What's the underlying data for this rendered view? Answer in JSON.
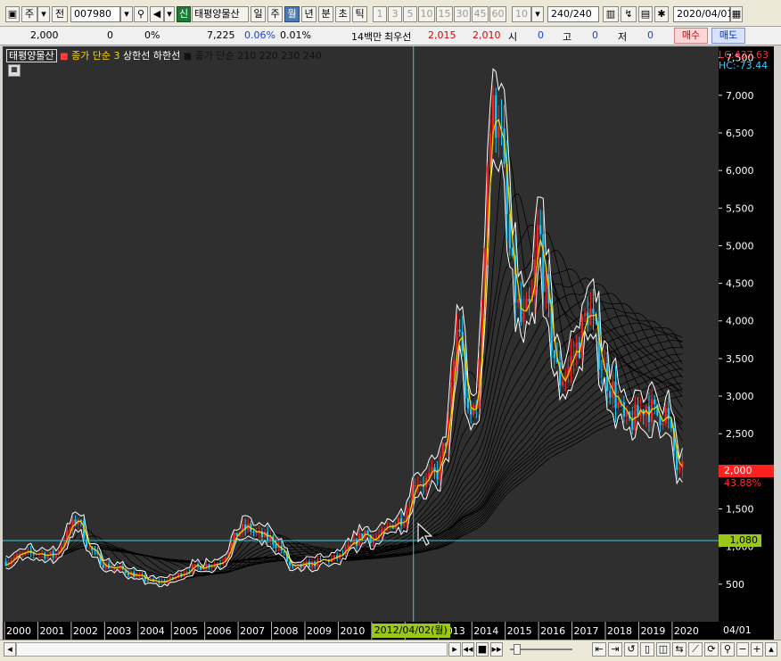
{
  "toolbar": {
    "market": "주",
    "prev_label": "전",
    "code": "007980",
    "credit_badge": "신",
    "stock_name": "태평양물산",
    "periods": [
      "일",
      "주",
      "월",
      "년",
      "분",
      "초",
      "틱"
    ],
    "selected_period": "월",
    "intervals": [
      "1",
      "3",
      "5",
      "10",
      "15",
      "30",
      "45",
      "60"
    ],
    "interval_select": "10",
    "count_value": "240",
    "count_total": "/240",
    "date": "2020/04/01"
  },
  "info_bar": {
    "price": "2,000",
    "change": "0",
    "change_pct": "0%",
    "volume": "7,225",
    "vol_pct": "0.06%",
    "turnover_pct": "0.01%",
    "amount": "14백만",
    "best_label": "최우선",
    "ask": "2,015",
    "bid": "2,010",
    "open_label": "시",
    "open_val": "0",
    "high_label": "고",
    "high_val": "0",
    "low_label": "저",
    "low_val": "0",
    "buy_label": "매수",
    "sell_label": "매도"
  },
  "legend": {
    "stock": "태평양물산",
    "ma_label": "종가 단순 3",
    "upper": "상한선",
    "lower": "하한선",
    "ma_group": "종가 단순 210  220  230  240"
  },
  "crosshair": {
    "x_label": "2012/04/02(월)",
    "y_label": "1,080"
  },
  "last_price": {
    "value": "2,000",
    "pct": "43.88%"
  },
  "lc_hc": {
    "lc": "LC:437.63",
    "hc": "HC:-73.44"
  },
  "xaxis_end": "04/01",
  "colors": {
    "background": "#2f2f2f",
    "up": "#ff2020",
    "down": "#19c8ff",
    "ma3": "#ffd700",
    "envelope": "#ffffff",
    "ma_long": "#000000",
    "crosshair": "#3ec8d8"
  },
  "chart_data": {
    "type": "line",
    "title": "",
    "x_ticks": [
      "2000",
      "2001",
      "2002",
      "2003",
      "2004",
      "2005",
      "2006",
      "2007",
      "2008",
      "2009",
      "2010",
      "2011",
      "2012",
      "2013",
      "2014",
      "2015",
      "2016",
      "2017",
      "2018",
      "2019",
      "2020"
    ],
    "y_ticks": [
      "500",
      "1,000",
      "1,500",
      "2,000",
      "2,500",
      "3,000",
      "3,500",
      "4,000",
      "4,500",
      "5,000",
      "5,500",
      "6,000",
      "6,500",
      "7,000",
      "7,500"
    ],
    "ylim": [
      0,
      7650
    ],
    "xlim": [
      2000.0,
      2020.35
    ],
    "series": [
      {
        "name": "종가",
        "x": [
          2000.0,
          2000.5,
          2001.0,
          2001.5,
          2002.0,
          2002.2,
          2002.5,
          2003.0,
          2003.5,
          2004.0,
          2004.5,
          2005.0,
          2005.5,
          2006.0,
          2006.5,
          2007.0,
          2007.3,
          2007.6,
          2008.0,
          2008.3,
          2008.6,
          2009.0,
          2009.5,
          2010.0,
          2010.4,
          2010.8,
          2011.0,
          2011.3,
          2011.6,
          2012.0,
          2012.3,
          2012.6,
          2013.0,
          2013.3,
          2013.6,
          2013.9,
          2014.2,
          2014.5,
          2014.8,
          2015.0,
          2015.2,
          2015.5,
          2015.8,
          2016.0,
          2016.3,
          2016.6,
          2016.9,
          2017.2,
          2017.5,
          2017.8,
          2018.0,
          2018.3,
          2018.6,
          2018.9,
          2019.2,
          2019.5,
          2019.8,
          2020.0,
          2020.2,
          2020.25
        ],
        "values": [
          800,
          880,
          920,
          870,
          1250,
          1400,
          1000,
          750,
          700,
          600,
          520,
          560,
          700,
          750,
          800,
          1200,
          1250,
          1150,
          1100,
          950,
          700,
          750,
          800,
          850,
          1000,
          1200,
          1100,
          1150,
          1300,
          1400,
          1900,
          1850,
          2000,
          2600,
          4100,
          2600,
          3100,
          6500,
          6900,
          5600,
          4600,
          3900,
          4200,
          5300,
          4000,
          3200,
          3400,
          3700,
          4200,
          3600,
          3300,
          3000,
          2600,
          2700,
          2900,
          2750,
          2800,
          2400,
          1900,
          2000
        ]
      }
    ]
  }
}
